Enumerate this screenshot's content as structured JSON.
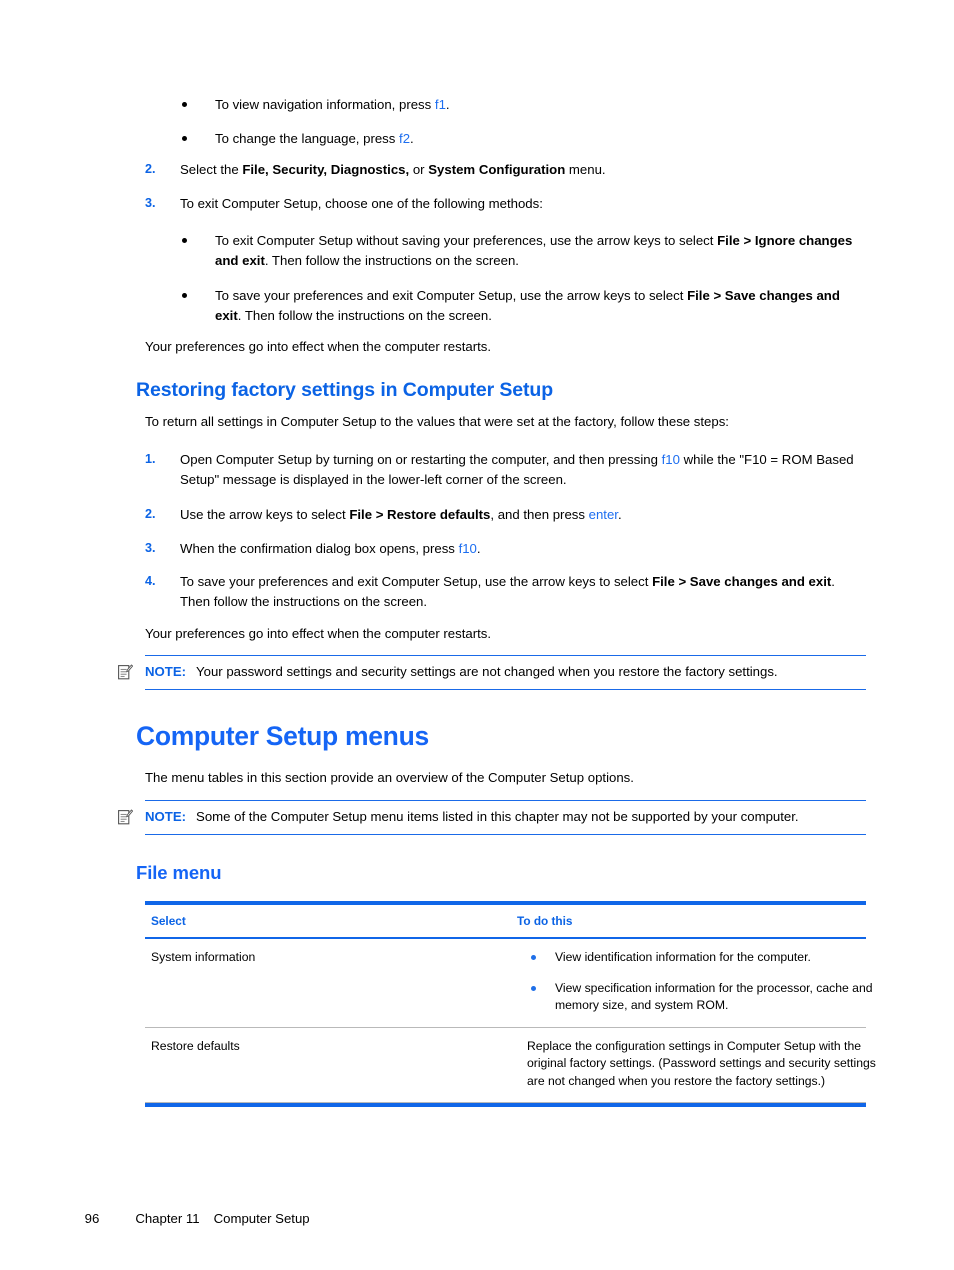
{
  "document": {
    "page_number": "96",
    "chapter_label": "Chapter 11",
    "chapter_title": "Computer Setup",
    "footer_text": "96     Chapter 11   Computer Setup"
  },
  "colors": {
    "heading_blue": "#1565f5",
    "subheading_blue": "#0b63e5",
    "key_blue": "#1d6ef0",
    "rule_blue": "#1066e8",
    "table_bullet_blue": "#1f6fe8"
  },
  "top_section": {
    "bullets": [
      {
        "pre": "To view navigation information, press ",
        "key": "f1",
        "post": "."
      },
      {
        "pre": "To change the language, press ",
        "key": "f2",
        "post": "."
      }
    ],
    "steps": [
      {
        "marker": "2.",
        "parts": [
          {
            "t": "Select the ",
            "style": "normal"
          },
          {
            "t": "File, Security, Diagnostics,",
            "style": "bold"
          },
          {
            "t": " or ",
            "style": "normal"
          },
          {
            "t": "System Configuration",
            "style": "bold"
          },
          {
            "t": " menu.",
            "style": "normal"
          }
        ]
      },
      {
        "marker": "3.",
        "parts": [
          {
            "t": "To exit Computer Setup, choose one of the following methods:",
            "style": "normal"
          }
        ]
      }
    ],
    "exit_bullets": [
      {
        "parts": [
          {
            "t": "To exit Computer Setup without saving your preferences, use the arrow keys to select ",
            "style": "normal"
          },
          {
            "t": "File > Ignore changes and exit",
            "style": "bold"
          },
          {
            "t": ". Then follow the instructions on the screen.",
            "style": "normal"
          }
        ]
      },
      {
        "parts": [
          {
            "t": "To save your preferences and exit Computer Setup, use the arrow keys to select ",
            "style": "normal"
          },
          {
            "t": "File > Save changes and exit",
            "style": "bold"
          },
          {
            "t": ". Then follow the instructions on the screen.",
            "style": "normal"
          }
        ]
      }
    ],
    "closing_paragraph": "Your preferences go into effect when the computer restarts."
  },
  "restoring_section": {
    "heading": "Restoring factory settings in Computer Setup",
    "intro": "To return all settings in Computer Setup to the values that were set at the factory, follow these steps:",
    "steps": [
      {
        "marker": "1.",
        "parts": [
          {
            "t": "Open Computer Setup by turning on or restarting the computer, and then pressing ",
            "style": "normal"
          },
          {
            "t": "f10",
            "style": "key"
          },
          {
            "t": " while the \"F10 = ROM Based Setup\" message is displayed in the lower-left corner of the screen.",
            "style": "normal"
          }
        ]
      },
      {
        "marker": "2.",
        "parts": [
          {
            "t": "Use the arrow keys to select ",
            "style": "normal"
          },
          {
            "t": "File > Restore defaults",
            "style": "bold"
          },
          {
            "t": ", and then press ",
            "style": "normal"
          },
          {
            "t": "enter",
            "style": "key"
          },
          {
            "t": ".",
            "style": "normal"
          }
        ]
      },
      {
        "marker": "3.",
        "parts": [
          {
            "t": "When the confirmation dialog box opens, press ",
            "style": "normal"
          },
          {
            "t": "f10",
            "style": "key"
          },
          {
            "t": ".",
            "style": "normal"
          }
        ]
      },
      {
        "marker": "4.",
        "parts": [
          {
            "t": "To save your preferences and exit Computer Setup, use the arrow keys to select ",
            "style": "normal"
          },
          {
            "t": "File > Save changes and exit",
            "style": "bold"
          },
          {
            "t": ". Then follow the instructions on the screen.",
            "style": "normal"
          }
        ]
      }
    ],
    "closing_paragraph": "Your preferences go into effect when the computer restarts.",
    "note": {
      "label": "NOTE:",
      "text": "Your password settings and security settings are not changed when you restore the factory settings."
    }
  },
  "menus_section": {
    "heading": "Computer Setup menus",
    "intro": "The menu tables in this section provide an overview of the Computer Setup options.",
    "note": {
      "label": "NOTE:",
      "text": "Some of the Computer Setup menu items listed in this chapter may not be supported by your computer."
    }
  },
  "file_menu": {
    "heading": "File menu",
    "table": {
      "headers": [
        "Select",
        "To do this"
      ],
      "rows": [
        {
          "select": "System information",
          "bullets": [
            "View identification information for the computer.",
            "View specification information for the processor, cache and memory size, and system ROM."
          ],
          "text": null
        },
        {
          "select": "Restore defaults",
          "bullets": null,
          "text": "Replace the configuration settings in Computer Setup with the original factory settings. (Password settings and security settings are not changed when you restore the factory settings.)"
        }
      ]
    }
  }
}
